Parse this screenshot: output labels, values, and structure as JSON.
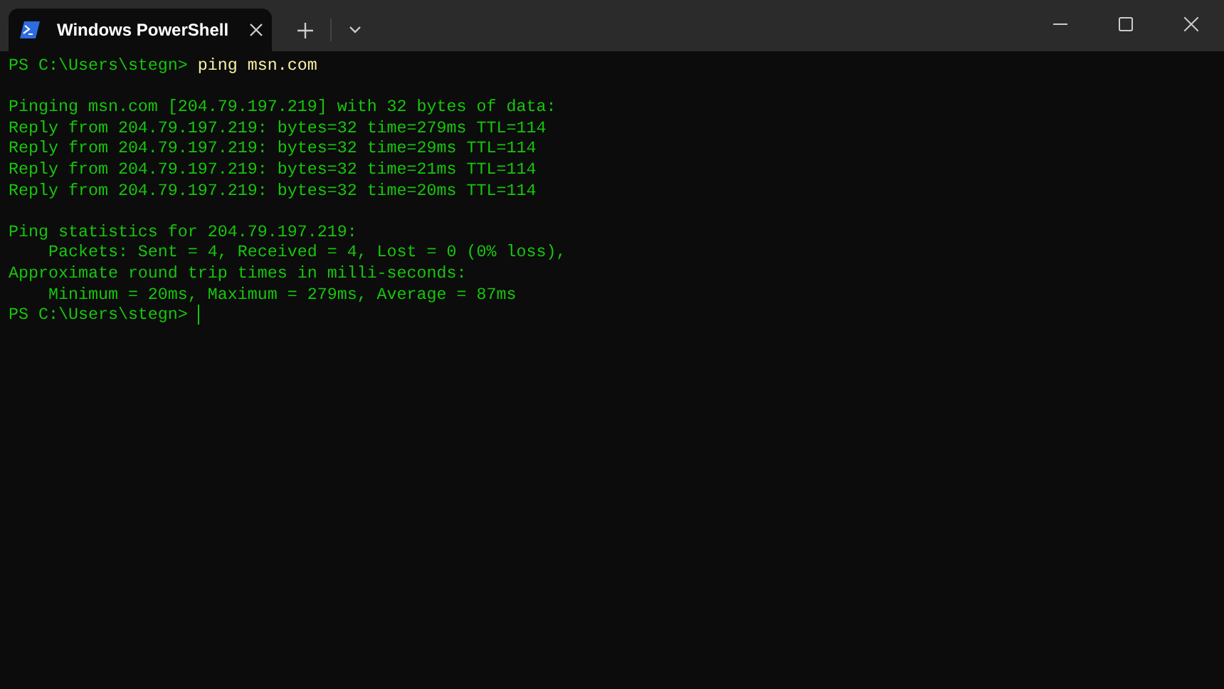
{
  "window": {
    "tabs": [
      {
        "title": "Windows PowerShell",
        "selected": true
      }
    ]
  },
  "terminal": {
    "lines": [
      {
        "kind": "prompt",
        "prompt": "PS C:\\Users\\stegn>",
        "command": "ping msn.com",
        "cursor": false
      },
      {
        "kind": "blank"
      },
      {
        "kind": "output",
        "text": "Pinging msn.com [204.79.197.219] with 32 bytes of data:"
      },
      {
        "kind": "output",
        "text": "Reply from 204.79.197.219: bytes=32 time=279ms TTL=114"
      },
      {
        "kind": "output",
        "text": "Reply from 204.79.197.219: bytes=32 time=29ms TTL=114"
      },
      {
        "kind": "output",
        "text": "Reply from 204.79.197.219: bytes=32 time=21ms TTL=114"
      },
      {
        "kind": "output",
        "text": "Reply from 204.79.197.219: bytes=32 time=20ms TTL=114"
      },
      {
        "kind": "blank"
      },
      {
        "kind": "output",
        "text": "Ping statistics for 204.79.197.219:"
      },
      {
        "kind": "output",
        "text": "    Packets: Sent = 4, Received = 4, Lost = 0 (0% loss),"
      },
      {
        "kind": "output",
        "text": "Approximate round trip times in milli-seconds:"
      },
      {
        "kind": "output",
        "text": "    Minimum = 20ms, Maximum = 279ms, Average = 87ms"
      },
      {
        "kind": "prompt",
        "prompt": "PS C:\\Users\\stegn>",
        "cursor": true
      }
    ]
  }
}
